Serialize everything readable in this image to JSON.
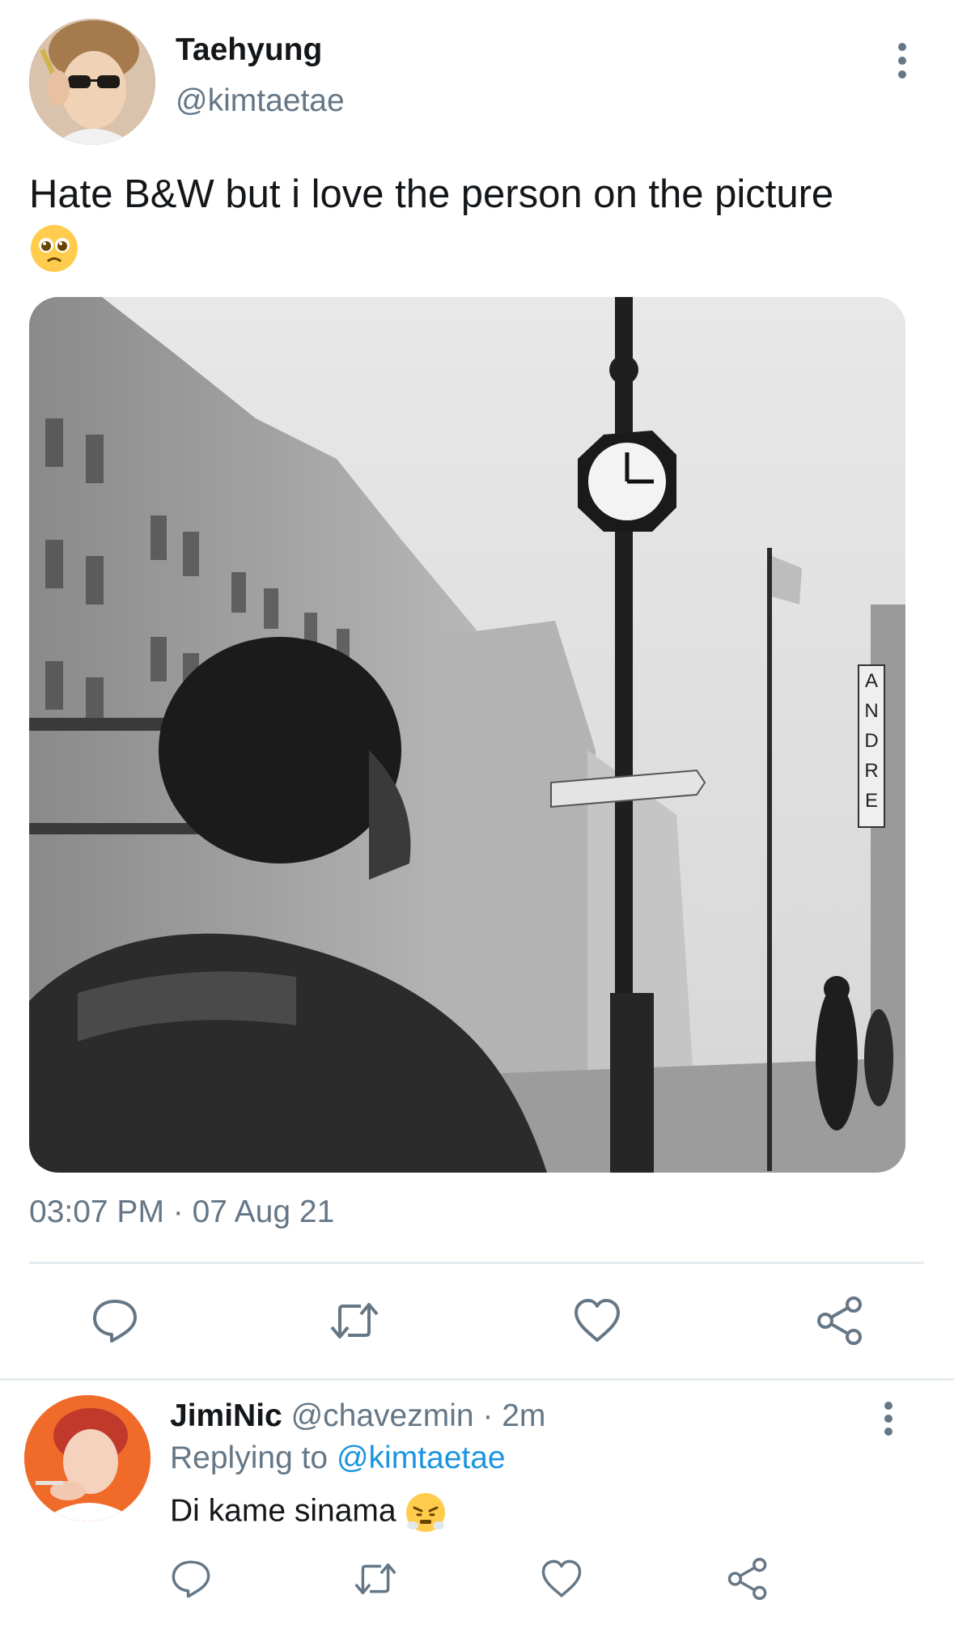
{
  "tweet": {
    "display_name": "Taehyung",
    "handle": "@kimtaetae",
    "text": "Hate B&W but i love the person on the picture",
    "emoji": "pleading-face",
    "timestamp": "03:07 PM · 07 Aug 21",
    "photo_sign_letters": "ANDRE"
  },
  "icons": {
    "reply": "reply-icon",
    "retweet": "retweet-icon",
    "like": "heart-icon",
    "share": "share-icon",
    "more": "more-vertical-icon"
  },
  "reply": {
    "display_name": "JimiNic",
    "meta": "@chavezmin · 2m",
    "replying_prefix": "Replying to ",
    "replying_handle": "@kimtaetae",
    "text": "Di kame sinama",
    "emoji": "face-with-steam"
  },
  "colors": {
    "text_primary": "#14171a",
    "text_secondary": "#657786",
    "link": "#1b95e0",
    "divider": "#e6ecf0"
  }
}
